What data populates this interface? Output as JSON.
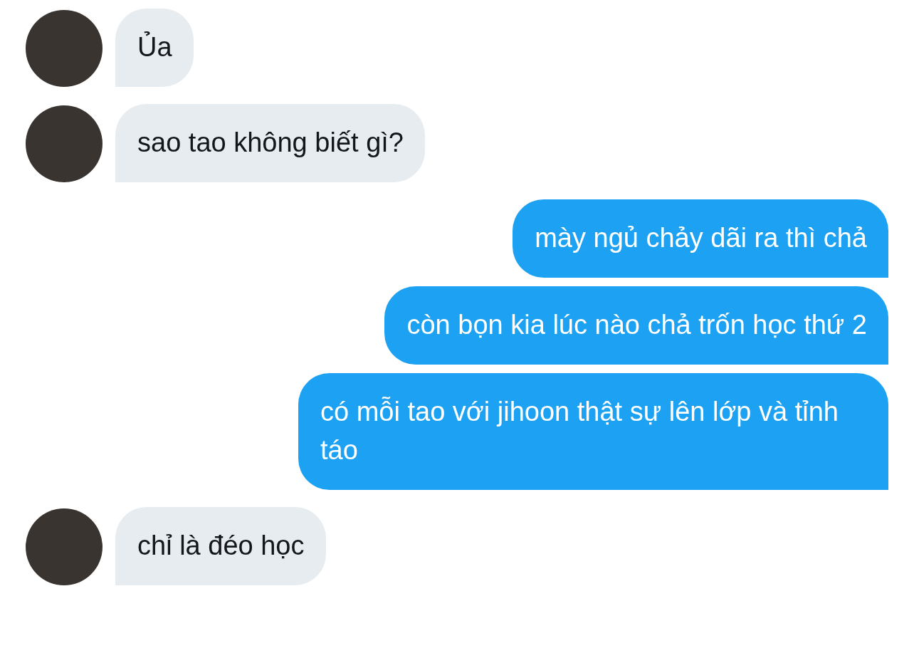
{
  "messages": [
    {
      "kind": "received",
      "text": "Ủa"
    },
    {
      "kind": "received",
      "text": "sao tao không biết gì?"
    },
    {
      "kind": "sent",
      "text": "mày ngủ chảy dãi ra thì chả"
    },
    {
      "kind": "sent",
      "text": "còn bọn kia lúc nào chả trốn học thứ 2"
    },
    {
      "kind": "sent",
      "text": "có mỗi tao với jihoon thật sự lên lớp và tỉnh táo"
    },
    {
      "kind": "received",
      "text": "chỉ là đéo học"
    }
  ]
}
